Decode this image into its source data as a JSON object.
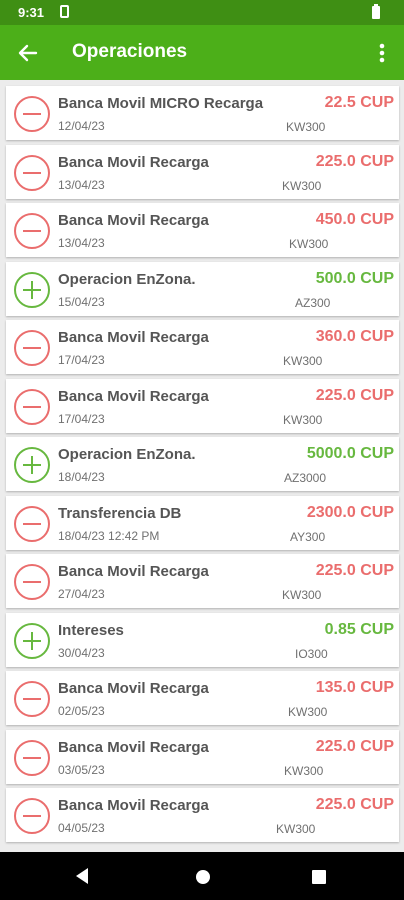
{
  "status": {
    "time": "9:31"
  },
  "header": {
    "title": "Operaciones"
  },
  "colors": {
    "status_bar": "#3f8f14",
    "app_bar": "#4caf19",
    "debit": "#ea6d6d",
    "credit": "#67b83f"
  },
  "operations": [
    {
      "title": "Banca Movil MICRO Recarga",
      "date": "12/04/23",
      "amount": "22.5 CUP",
      "code": "KW300",
      "type": "debit"
    },
    {
      "title": "Banca Movil Recarga",
      "date": "13/04/23",
      "amount": "225.0 CUP",
      "code": "KW300",
      "type": "debit"
    },
    {
      "title": "Banca Movil Recarga",
      "date": "13/04/23",
      "amount": "450.0 CUP",
      "code": "KW300",
      "type": "debit"
    },
    {
      "title": "Operacion EnZona.",
      "date": "15/04/23",
      "amount": "500.0 CUP",
      "code": "AZ300",
      "type": "credit"
    },
    {
      "title": "Banca Movil Recarga",
      "date": "17/04/23",
      "amount": "360.0 CUP",
      "code": "KW300",
      "type": "debit"
    },
    {
      "title": "Banca Movil Recarga",
      "date": "17/04/23",
      "amount": "225.0 CUP",
      "code": "KW300",
      "type": "debit"
    },
    {
      "title": "Operacion EnZona.",
      "date": "18/04/23",
      "amount": "5000.0 CUP",
      "code": "AZ3000",
      "type": "credit"
    },
    {
      "title": "Transferencia DB",
      "date": "18/04/23 12:42 PM",
      "amount": "2300.0 CUP",
      "code": "AY300",
      "type": "debit"
    },
    {
      "title": "Banca Movil Recarga",
      "date": "27/04/23",
      "amount": "225.0 CUP",
      "code": "KW300",
      "type": "debit"
    },
    {
      "title": "Intereses",
      "date": "30/04/23",
      "amount": "0.85 CUP",
      "code": "IO300",
      "type": "credit"
    },
    {
      "title": "Banca Movil Recarga",
      "date": "02/05/23",
      "amount": "135.0 CUP",
      "code": "KW300",
      "type": "debit"
    },
    {
      "title": "Banca Movil Recarga",
      "date": "03/05/23",
      "amount": "225.0 CUP",
      "code": "KW300",
      "type": "debit"
    },
    {
      "title": "Banca Movil Recarga",
      "date": "04/05/23",
      "amount": "225.0 CUP",
      "code": "KW300",
      "type": "debit"
    }
  ]
}
